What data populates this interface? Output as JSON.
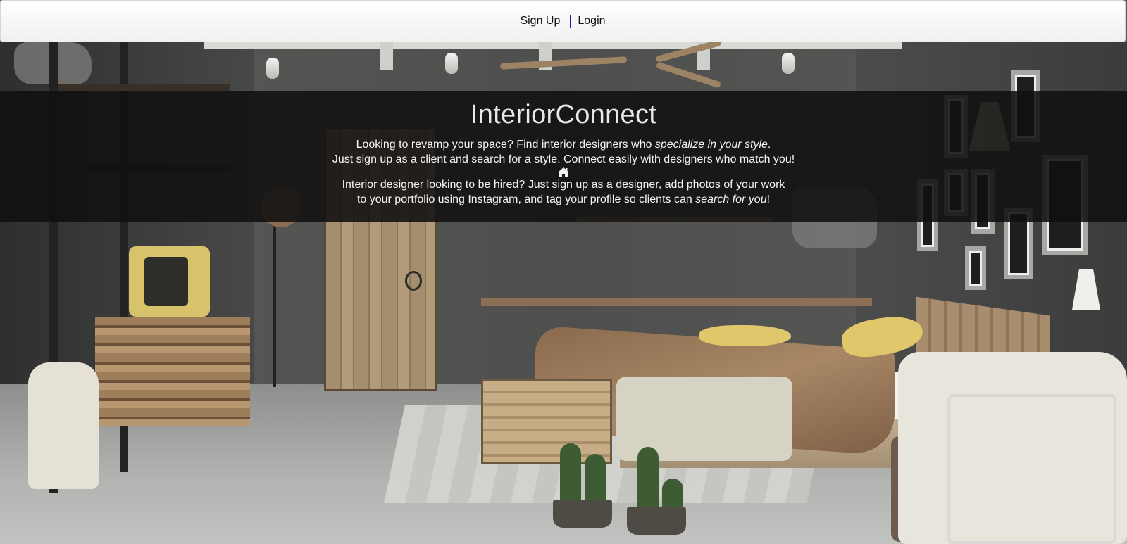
{
  "nav": {
    "signup_label": "Sign Up",
    "login_label": "Login"
  },
  "hero": {
    "title": "InteriorConnect",
    "client_intro": "Looking to revamp your space? Find interior designers who ",
    "client_emphasis": "specialize in your style",
    "client_intro_end": ".",
    "client_line2": "Just sign up as a client and search for a style. Connect easily with designers who match you!",
    "divider_icon": "home-icon",
    "designer_line1": "Interior designer looking to be hired? Just sign up as a designer, add photos of your work",
    "designer_line2": "to your portfolio using Instagram, and tag your profile so clients can ",
    "designer_emphasis": "search for you",
    "designer_line2_end": "!"
  },
  "colors": {
    "nav_separator": "#1a1aa8",
    "hero_overlay": "#101010"
  }
}
